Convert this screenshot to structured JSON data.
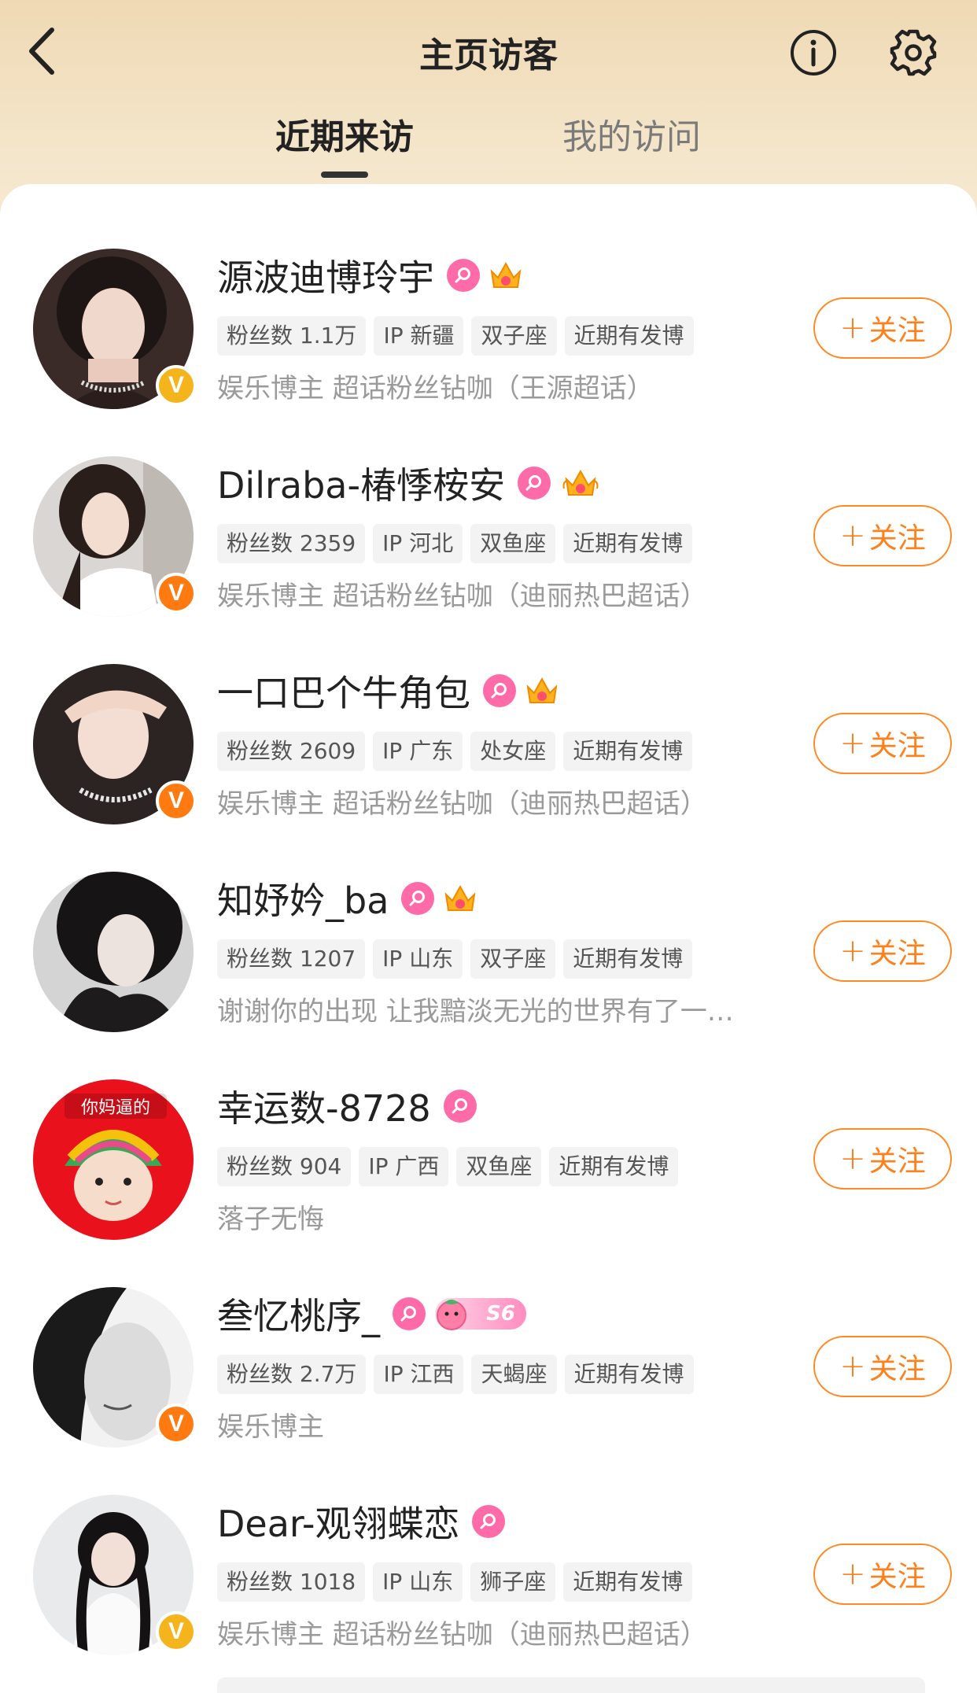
{
  "header": {
    "title": "主页访客"
  },
  "tabs": [
    {
      "label": "近期来访",
      "active": true
    },
    {
      "label": "我的访问",
      "active": false
    }
  ],
  "follow_label": "关注",
  "follow_plus": "+",
  "verified_mark": "V",
  "visitors": [
    {
      "name": "源波迪博玲宇",
      "badges": [
        "female-icon",
        "crown-icon"
      ],
      "verified": "gold",
      "tags": [
        "粉丝数 1.1万",
        "IP 新疆",
        "双子座",
        "近期有发博"
      ],
      "desc": "娱乐博主 超话粉丝钻咖（王源超话）"
    },
    {
      "name": "Dilraba-椿悸桉安",
      "badges": [
        "female-icon",
        "crown-icon"
      ],
      "verified": "orange",
      "tags": [
        "粉丝数 2359",
        "IP 河北",
        "双鱼座",
        "近期有发博"
      ],
      "desc": "娱乐博主 超话粉丝钻咖（迪丽热巴超话）"
    },
    {
      "name": "一口巴个牛角包",
      "badges": [
        "female-icon",
        "crown-icon"
      ],
      "verified": "orange",
      "tags": [
        "粉丝数 2609",
        "IP 广东",
        "处女座",
        "近期有发博"
      ],
      "desc": "娱乐博主 超话粉丝钻咖（迪丽热巴超话）"
    },
    {
      "name": "知妤妗_ba",
      "badges": [
        "female-icon",
        "crown-icon"
      ],
      "verified": "",
      "tags": [
        "粉丝数 1207",
        "IP 山东",
        "双子座",
        "近期有发博"
      ],
      "desc": "谢谢你的出现 让我黯淡无光的世界有了一…"
    },
    {
      "name": "幸运数-8728",
      "badges": [
        "female-icon"
      ],
      "verified": "",
      "avatar_text": "你妈逼的",
      "tags": [
        "粉丝数 904",
        "IP 广西",
        "双鱼座",
        "近期有发博"
      ],
      "desc": "落子无悔"
    },
    {
      "name": "叁忆桃序_",
      "badges": [
        "female-icon",
        "level-badge"
      ],
      "level": "S6",
      "verified": "orange",
      "tags": [
        "粉丝数 2.7万",
        "IP 江西",
        "天蝎座",
        "近期有发博"
      ],
      "desc": "娱乐博主"
    },
    {
      "name": "Dear-观翎蝶恋",
      "badges": [
        "female-icon"
      ],
      "verified": "gold",
      "tags": [
        "粉丝数 1018",
        "IP 山东",
        "狮子座",
        "近期有发博"
      ],
      "desc": "娱乐博主 超话粉丝钻咖（迪丽热巴超话）"
    }
  ],
  "colors": {
    "accent": "#ff7f1a",
    "female": "#ff6aa8",
    "verified_gold": "#f4b51c",
    "verified_orange": "#ff7a10"
  }
}
